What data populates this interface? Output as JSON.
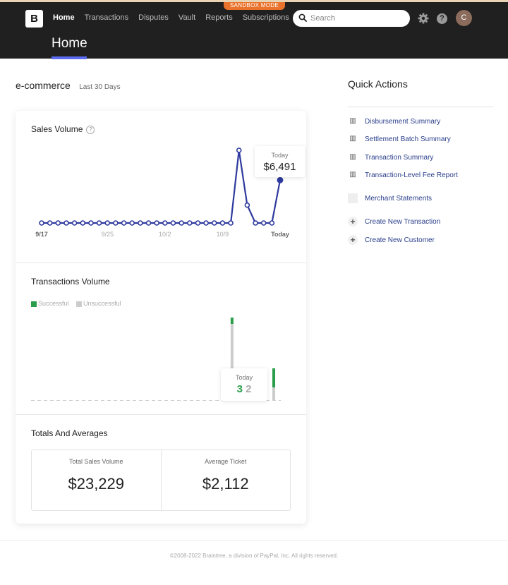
{
  "header": {
    "sandbox_label": "SANDBOX MODE",
    "logo_letter": "B",
    "nav": [
      "Home",
      "Transactions",
      "Disputes",
      "Vault",
      "Reports",
      "Subscriptions"
    ],
    "search_placeholder": "Search",
    "help_label": "?",
    "avatar_letter": "C",
    "page_title": "Home",
    "accent": "#5b6cf0"
  },
  "section": {
    "title": "e-commerce",
    "subtitle": "Last 30 Days"
  },
  "sales_volume": {
    "title": "Sales Volume",
    "tooltip_label": "Today",
    "tooltip_value": "$6,491",
    "x_ticks": [
      "9/17",
      "9/25",
      "10/2",
      "10/9",
      "Today"
    ],
    "color": "#2e3a9e"
  },
  "transactions_volume": {
    "title": "Transactions Volume",
    "legend": [
      {
        "label": "Successful",
        "color": "#2a9d4a"
      },
      {
        "label": "Unsuccessful",
        "color": "#cccccc"
      }
    ],
    "tooltip_label": "Today",
    "tooltip_successful": "3",
    "tooltip_unsuccessful": "2"
  },
  "totals": {
    "title": "Totals And Averages",
    "total_sales_label": "Total Sales Volume",
    "total_sales_value": "$23,229",
    "avg_ticket_label": "Average Ticket",
    "avg_ticket_value": "$2,112"
  },
  "quick_actions": {
    "title": "Quick Actions",
    "items": [
      {
        "label": "Disbursement Summary",
        "icon": "report-icon"
      },
      {
        "label": "Settlement Batch Summary",
        "icon": "report-icon"
      },
      {
        "label": "Transaction Summary",
        "icon": "report-icon"
      },
      {
        "label": "Transaction-Level Fee Report",
        "icon": "report-icon"
      },
      {
        "label": "Merchant Statements",
        "icon": "document-icon"
      },
      {
        "label": "Create New Transaction",
        "icon": "plus-icon"
      },
      {
        "label": "Create New Customer",
        "icon": "plus-icon"
      }
    ]
  },
  "footer": "©2008-2022 Braintree, a division of PayPal, Inc. All rights reserved.",
  "chart_data": [
    {
      "type": "line",
      "title": "Sales Volume",
      "x_ticks": [
        "9/17",
        "9/25",
        "10/2",
        "10/9",
        "Today"
      ],
      "series": [
        {
          "values": [
            0,
            0,
            0,
            0,
            0,
            0,
            0,
            0,
            0,
            0,
            0,
            0,
            0,
            0,
            0,
            0,
            0,
            0,
            0,
            0,
            0,
            0,
            0,
            0,
            11000,
            2700,
            0,
            0,
            0,
            6491
          ]
        }
      ]
    },
    {
      "type": "bar",
      "title": "Transactions Volume",
      "legend": [
        "Successful",
        "Unsuccessful"
      ],
      "series": [
        {
          "name": "Successful",
          "values": [
            0,
            0,
            0,
            0,
            0,
            0,
            0,
            0,
            0,
            0,
            0,
            0,
            0,
            0,
            0,
            0,
            0,
            0,
            0,
            0,
            0,
            0,
            0,
            0,
            1,
            0,
            0,
            0,
            0,
            3
          ]
        },
        {
          "name": "Unsuccessful",
          "values": [
            0,
            0,
            0,
            0,
            0,
            0,
            0,
            0,
            0,
            0,
            0,
            0,
            0,
            0,
            0,
            0,
            0,
            0,
            0,
            0,
            0,
            0,
            0,
            0,
            12,
            0,
            0,
            0,
            0,
            2
          ]
        }
      ]
    }
  ]
}
